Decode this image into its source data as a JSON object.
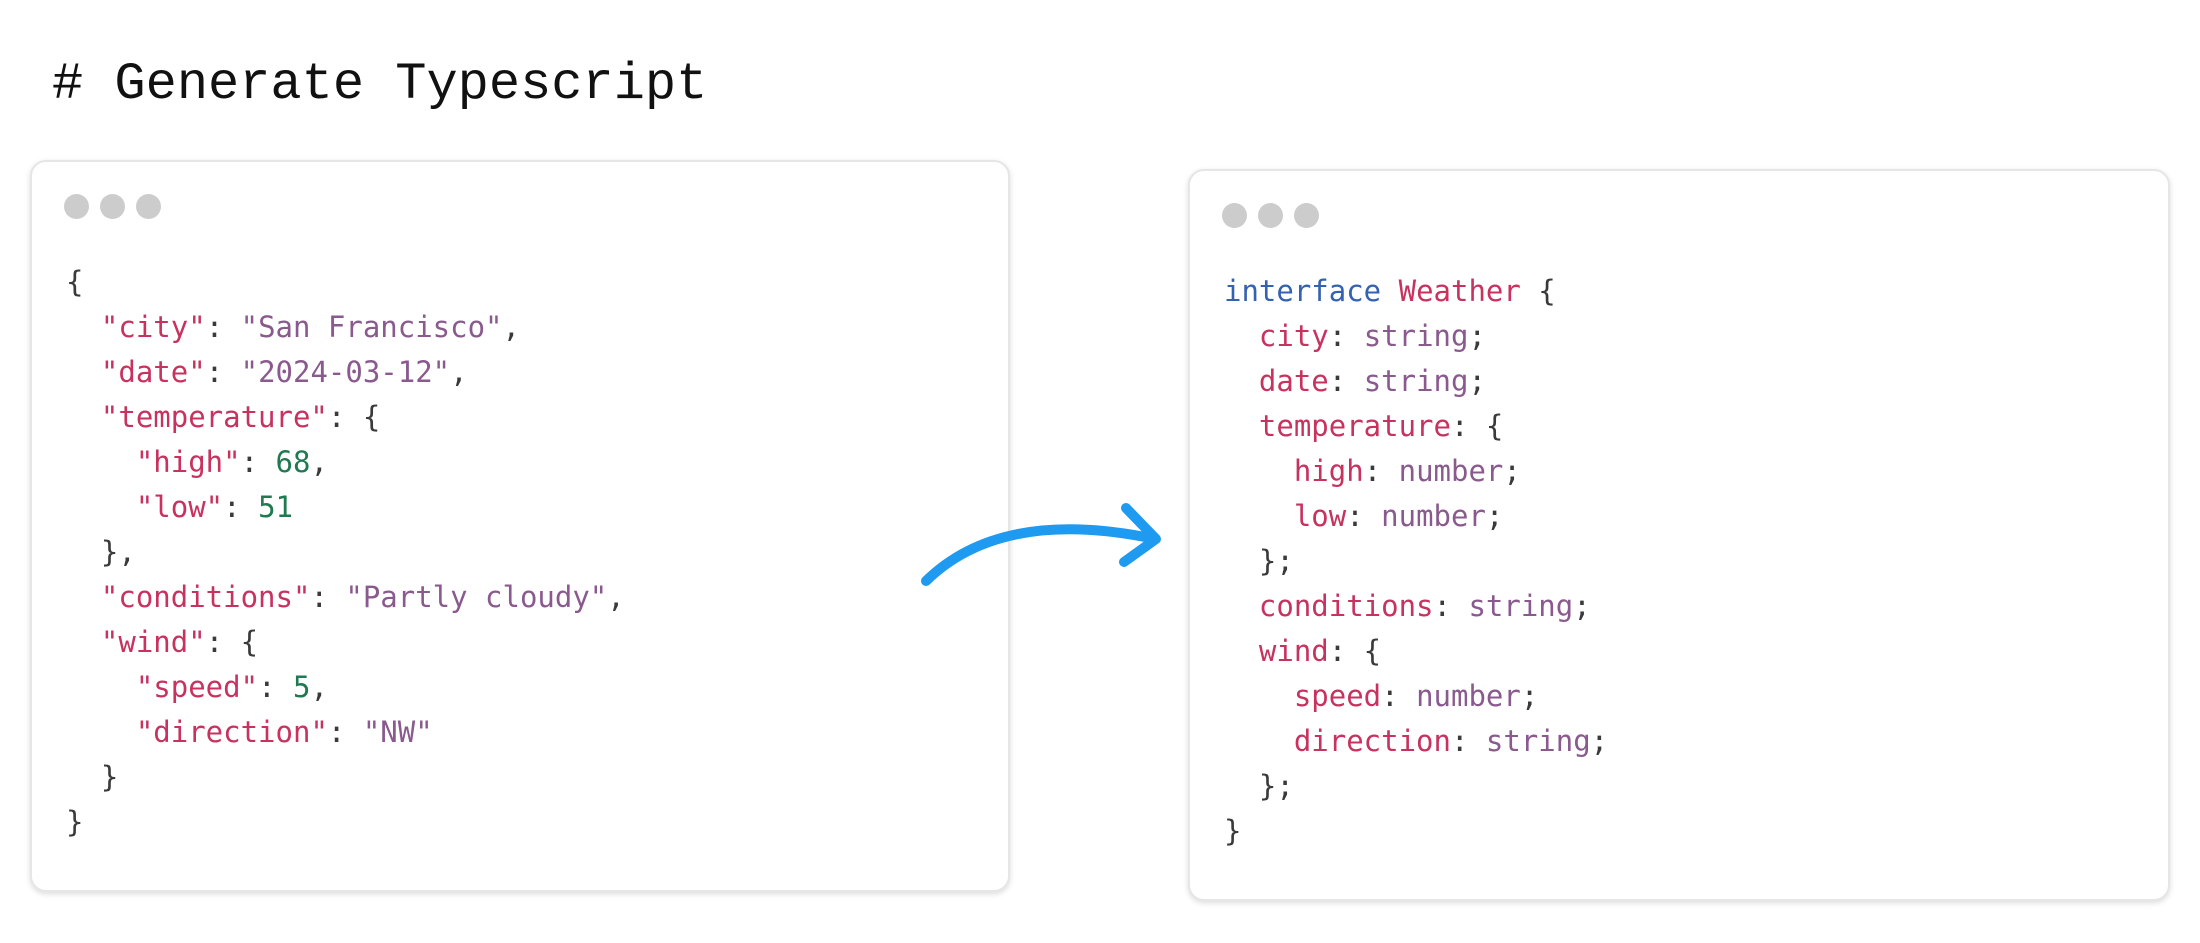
{
  "title": "# Generate Typescript",
  "colors": {
    "key": "#c7325f",
    "string": "#8a5a8f",
    "number": "#1f7a52",
    "keyword": "#3461b0",
    "punctuation": "#3a3a3a",
    "arrow": "#1e9bf0",
    "window_dot": "#cccccc"
  },
  "json_panel": {
    "lines": [
      [
        [
          "punct",
          "{"
        ]
      ],
      [
        [
          "punct",
          "  "
        ],
        [
          "key",
          "\"city\""
        ],
        [
          "punct",
          ": "
        ],
        [
          "string",
          "\"San Francisco\""
        ],
        [
          "punct",
          ","
        ]
      ],
      [
        [
          "punct",
          "  "
        ],
        [
          "key",
          "\"date\""
        ],
        [
          "punct",
          ": "
        ],
        [
          "string",
          "\"2024-03-12\""
        ],
        [
          "punct",
          ","
        ]
      ],
      [
        [
          "punct",
          "  "
        ],
        [
          "key",
          "\"temperature\""
        ],
        [
          "punct",
          ": {"
        ]
      ],
      [
        [
          "punct",
          "    "
        ],
        [
          "key",
          "\"high\""
        ],
        [
          "punct",
          ": "
        ],
        [
          "number",
          "68"
        ],
        [
          "punct",
          ","
        ]
      ],
      [
        [
          "punct",
          "    "
        ],
        [
          "key",
          "\"low\""
        ],
        [
          "punct",
          ": "
        ],
        [
          "number",
          "51"
        ]
      ],
      [
        [
          "punct",
          "  },"
        ]
      ],
      [
        [
          "punct",
          "  "
        ],
        [
          "key",
          "\"conditions\""
        ],
        [
          "punct",
          ": "
        ],
        [
          "string",
          "\"Partly cloudy\""
        ],
        [
          "punct",
          ","
        ]
      ],
      [
        [
          "punct",
          "  "
        ],
        [
          "key",
          "\"wind\""
        ],
        [
          "punct",
          ": {"
        ]
      ],
      [
        [
          "punct",
          "    "
        ],
        [
          "key",
          "\"speed\""
        ],
        [
          "punct",
          ": "
        ],
        [
          "number",
          "5"
        ],
        [
          "punct",
          ","
        ]
      ],
      [
        [
          "punct",
          "    "
        ],
        [
          "key",
          "\"direction\""
        ],
        [
          "punct",
          ": "
        ],
        [
          "string",
          "\"NW\""
        ]
      ],
      [
        [
          "punct",
          "  }"
        ]
      ],
      [
        [
          "punct",
          "}"
        ]
      ]
    ]
  },
  "ts_panel": {
    "lines": [
      [
        [
          "keyword",
          "interface"
        ],
        [
          "punct",
          " "
        ],
        [
          "type",
          "Weather"
        ],
        [
          "punct",
          " {"
        ]
      ],
      [
        [
          "punct",
          "  "
        ],
        [
          "key",
          "city"
        ],
        [
          "punct",
          ": "
        ],
        [
          "tstring",
          "string"
        ],
        [
          "punct",
          ";"
        ]
      ],
      [
        [
          "punct",
          "  "
        ],
        [
          "key",
          "date"
        ],
        [
          "punct",
          ": "
        ],
        [
          "tstring",
          "string"
        ],
        [
          "punct",
          ";"
        ]
      ],
      [
        [
          "punct",
          "  "
        ],
        [
          "key",
          "temperature"
        ],
        [
          "punct",
          ": {"
        ]
      ],
      [
        [
          "punct",
          "    "
        ],
        [
          "key",
          "high"
        ],
        [
          "punct",
          ": "
        ],
        [
          "tstring",
          "number"
        ],
        [
          "punct",
          ";"
        ]
      ],
      [
        [
          "punct",
          "    "
        ],
        [
          "key",
          "low"
        ],
        [
          "punct",
          ": "
        ],
        [
          "tstring",
          "number"
        ],
        [
          "punct",
          ";"
        ]
      ],
      [
        [
          "punct",
          "  };"
        ]
      ],
      [
        [
          "punct",
          "  "
        ],
        [
          "key",
          "conditions"
        ],
        [
          "punct",
          ": "
        ],
        [
          "tstring",
          "string"
        ],
        [
          "punct",
          ";"
        ]
      ],
      [
        [
          "punct",
          "  "
        ],
        [
          "key",
          "wind"
        ],
        [
          "punct",
          ": {"
        ]
      ],
      [
        [
          "punct",
          "    "
        ],
        [
          "key",
          "speed"
        ],
        [
          "punct",
          ": "
        ],
        [
          "tstring",
          "number"
        ],
        [
          "punct",
          ";"
        ]
      ],
      [
        [
          "punct",
          "    "
        ],
        [
          "key",
          "direction"
        ],
        [
          "punct",
          ": "
        ],
        [
          "tstring",
          "string"
        ],
        [
          "punct",
          ";"
        ]
      ],
      [
        [
          "punct",
          "  };"
        ]
      ],
      [
        [
          "punct",
          "}"
        ]
      ]
    ]
  }
}
